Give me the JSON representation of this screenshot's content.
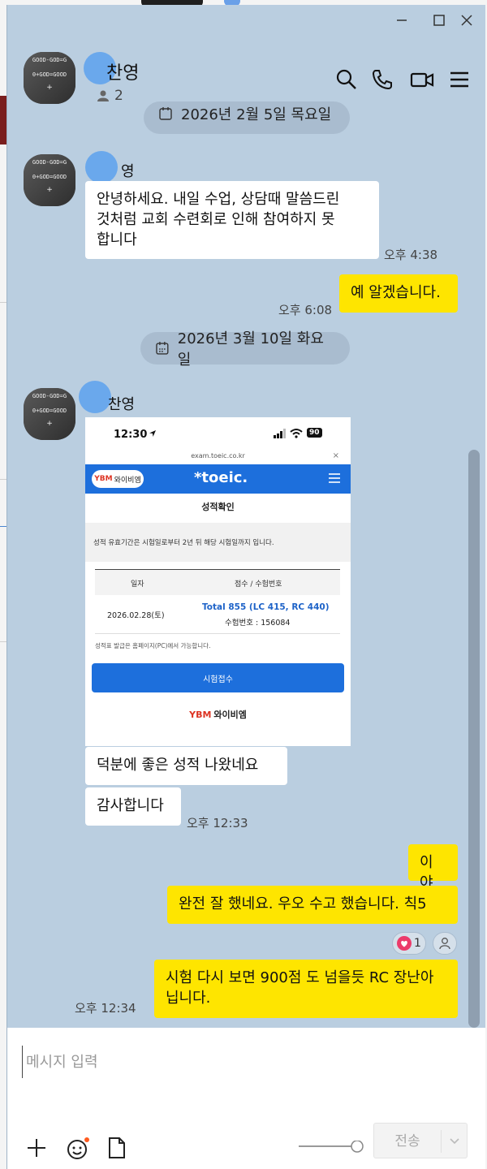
{
  "window": {
    "min_glyph": "—",
    "max_glyph": "☐",
    "close_glyph": "✕"
  },
  "header": {
    "name": "찬영",
    "member_count": "2"
  },
  "date_dividers": [
    "2026년 2월 5일 목요일",
    "2026년 3월 10일 화요일"
  ],
  "messages": {
    "m1_sender": "영",
    "m1_text_lines": [
      "안녕하세요. 내일 수업, 상담때 말씀드린",
      "것처럼 교회 수련회로 인해 참여하지 못",
      "합니다"
    ],
    "m1_time": "오후 4:38",
    "m2_text": "예 알겠습니다.",
    "m2_time": "오후 6:08",
    "m3_sender": "찬영",
    "m4_text": "덕분에 좋은 성적 나왔네요",
    "m5_text": "감사합니다",
    "m5_time": "오후 12:33",
    "m6_text": "이야",
    "m7_text": "완전 잘 했네요. 우오 수고 했습니다. 칙5",
    "m8_text_lines": [
      "시험 다시 보면 900점 도 넘을듯 RC 장난아",
      "닙니다."
    ],
    "m8_time": "오후 12:34",
    "reaction_count": "1"
  },
  "toeic_shot": {
    "clock": "12:30",
    "battery": "90",
    "url": "exam.toeic.co.kr",
    "close_glyph": "×",
    "brand": "와이비엠",
    "brand_mark": "YBM",
    "logo": "*toeic.",
    "page_title": "성적확인",
    "notice": "성적 유효기간은 시험일로부터 2년 뒤 해당 시험일까지 입니다.",
    "col_date": "일자",
    "col_score": "점수 / 수험번호",
    "date": "2026.02.28(토)",
    "score": "Total 855 (LC 415, RC 440)",
    "exam_no": "수험번호 : 156084",
    "note": "성적표 발급은 홈페이지(PC)에서 가능합니다.",
    "button": "시험접수",
    "footer_brand": "와이비엠",
    "footer_mark": "YBM"
  },
  "composer": {
    "placeholder": "메시지 입력",
    "send_label": "전송"
  },
  "colors": {
    "chat_bg": "#bacee0",
    "bubble_out": "#fee500",
    "bubble_in": "#ffffff",
    "toeic_blue": "#1d6fdc"
  }
}
